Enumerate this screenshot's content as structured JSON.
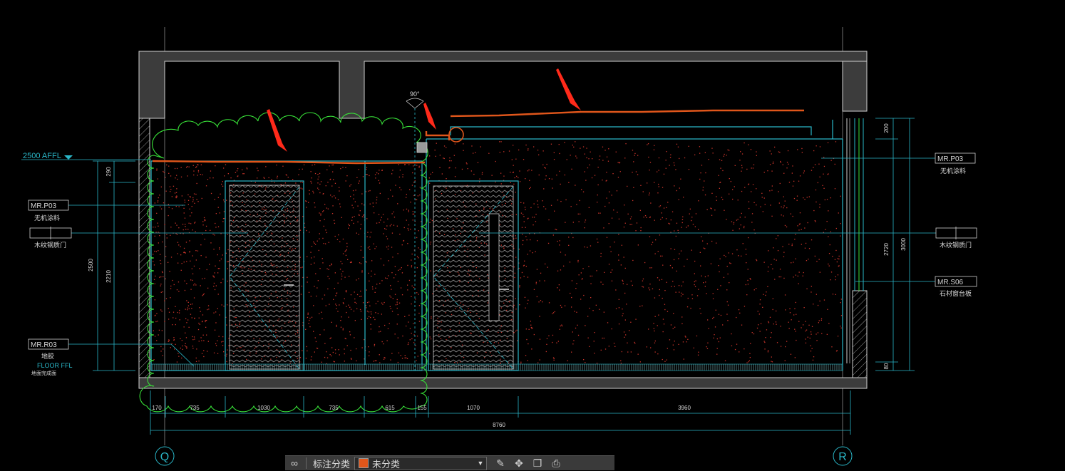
{
  "colors": {
    "wall": "#3c3c3c",
    "wall_edge": "#cfcfcf",
    "cyan": "#2ab7c8",
    "green": "#38e038",
    "orange": "#e0561b",
    "red_arrow": "#ff2a1a",
    "speckle": "#c8342a",
    "magenta": "#e23bd0",
    "text": "#d8d8d8"
  },
  "elevation_mark": "2500 AFFL",
  "left_tags": [
    {
      "code": "MR.P03",
      "desc": "无机涂料"
    },
    {
      "code": "",
      "desc": "木纹钢质门"
    },
    {
      "code": "MR.R03",
      "desc": "地胶",
      "extra1": "FLOOR FFL",
      "extra2": "地面完成面"
    }
  ],
  "right_tags": [
    {
      "code": "MR.P03",
      "desc": "无机涂料"
    },
    {
      "code": "",
      "desc": "木纹钢质门"
    },
    {
      "code": "MR.S06",
      "desc": "石材窗台板"
    }
  ],
  "angle_label": "90°",
  "left_dims": {
    "outer": "2500",
    "top": "290",
    "mid": "2210"
  },
  "right_dims": {
    "outer": "3000",
    "top": "200",
    "mid": "2720",
    "bottom": "80"
  },
  "bottom_dims": [
    "170",
    "735",
    "1030",
    "735",
    "615",
    "155",
    "1070",
    "3960"
  ],
  "total_dim": "8760",
  "grid_axes": {
    "left": "Q",
    "right": "R"
  },
  "toolbar": {
    "label": "标注分类",
    "selected": "未分类",
    "selected_color": "#e0561b"
  }
}
